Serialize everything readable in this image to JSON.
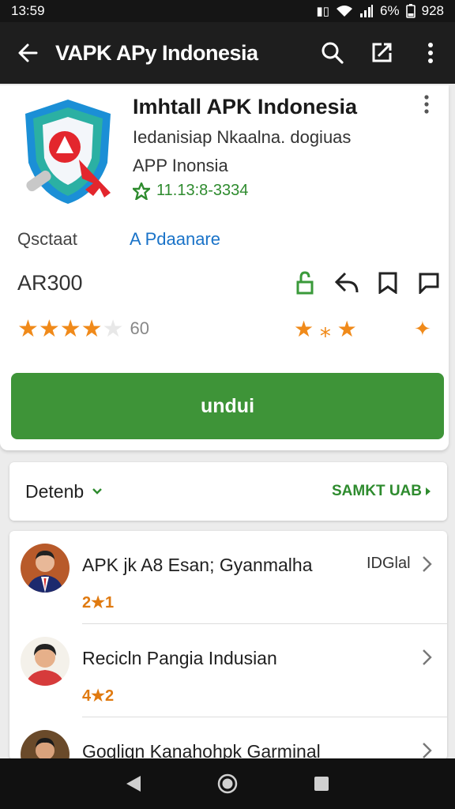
{
  "status": {
    "time": "13:59",
    "battery": "6%",
    "signal_text": "928"
  },
  "toolbar": {
    "title": "VAPK APy Indonesia"
  },
  "app": {
    "name": "Imhtall APK Indonesia",
    "desc_line1": "Iedanisiap Nkaalna. dogiuas",
    "desc_line2": "APP Inonsia",
    "meta": "11.13:8-3334",
    "category_label": "Qsctaat",
    "category_value": "A Pdaanare",
    "size": "AR300",
    "rating_value": 4,
    "rating_max": 5,
    "rating_count": "60",
    "download_label": "undui"
  },
  "filter": {
    "selected": "Detenb",
    "link_label": "SAMKT UAB"
  },
  "list": [
    {
      "title": "APK jk A8 Esan; Gyanmalha",
      "badge": "IDGlal",
      "rating": "2★1"
    },
    {
      "title": "Recicln Pangia Indusian",
      "badge": "",
      "rating": "4★2"
    },
    {
      "title": "Goglign Kanahohpk Garminal",
      "badge": "",
      "rating": ""
    }
  ],
  "colors": {
    "accent_green": "#3e9438",
    "link_blue": "#1a73c8",
    "star_orange": "#f08a1a"
  }
}
